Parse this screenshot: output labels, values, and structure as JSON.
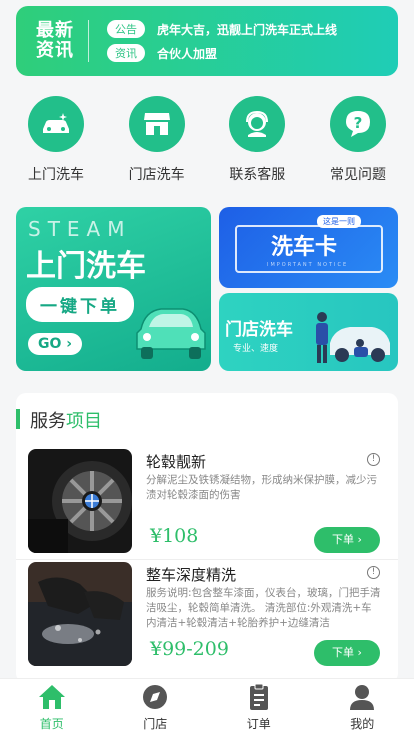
{
  "news": {
    "title_line1": "最新",
    "title_line2": "资讯",
    "items": [
      {
        "tag": "公告",
        "text": "虎年大吉，迅靓上门洗车正式上线"
      },
      {
        "tag": "资讯",
        "text": "合伙人加盟"
      }
    ]
  },
  "menu": [
    {
      "label": "上门洗车",
      "icon": "car-wash-icon"
    },
    {
      "label": "门店洗车",
      "icon": "store-icon"
    },
    {
      "label": "联系客服",
      "icon": "customer-service-icon"
    },
    {
      "label": "常见问题",
      "icon": "question-icon"
    }
  ],
  "promo_main": {
    "steam": "STEAM",
    "title": "上门洗车",
    "button": "一键下单",
    "go": "GO ›"
  },
  "promo_card": {
    "top": "这是一则",
    "title": "洗车卡",
    "subtitle": "IMPORTANT NOTICE"
  },
  "promo_store": {
    "title": "门店洗车",
    "subtitle": "专业、速度"
  },
  "services": {
    "heading_part1": "服务",
    "heading_part2": "项目",
    "items": [
      {
        "title": "轮毂靓新",
        "desc": "分解泥尘及铁锈凝结物，形成纳米保护膜，减少污渍对轮毂漆面的伤害",
        "price": "¥108",
        "button": "下单 ›"
      },
      {
        "title": "整车深度精洗",
        "desc": "服务说明:包含整车漆面，仪表台，玻璃，门把手清洁吸尘，轮毂简单清洗。 清洗部位:外观清洗+车内清洁+轮毂清洁+轮胎养护+边缝清洁",
        "price": "¥99-209",
        "button": "下单 ›"
      }
    ]
  },
  "tabbar": [
    {
      "label": "首页",
      "icon": "home-icon",
      "active": true
    },
    {
      "label": "门店",
      "icon": "compass-icon",
      "active": false
    },
    {
      "label": "订单",
      "icon": "order-icon",
      "active": false
    },
    {
      "label": "我的",
      "icon": "user-icon",
      "active": false
    }
  ],
  "colors": {
    "accent": "#2ebe6a",
    "teal": "#22bf8a",
    "card_blue": "#1e5fe6"
  }
}
